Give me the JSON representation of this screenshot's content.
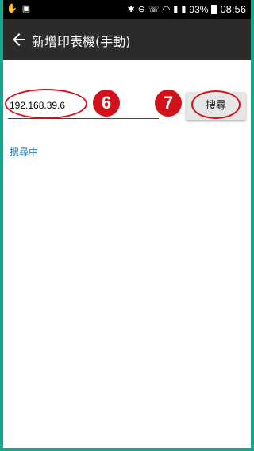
{
  "status_bar": {
    "battery": "93%",
    "time": "08:56"
  },
  "app_bar": {
    "title": "新增印表機(手動)",
    "back_icon": "arrow-left-icon"
  },
  "form": {
    "ip_value": "192.168.39.6",
    "search_label": "搜尋",
    "status_text": "搜尋中"
  },
  "annotations": {
    "badge_6": "6",
    "badge_7": "7",
    "color": "#d0131b"
  },
  "colors": {
    "app_bar": "#2b2b2b",
    "frame_border": "#16a88c",
    "link_text": "#2a7bbd"
  }
}
